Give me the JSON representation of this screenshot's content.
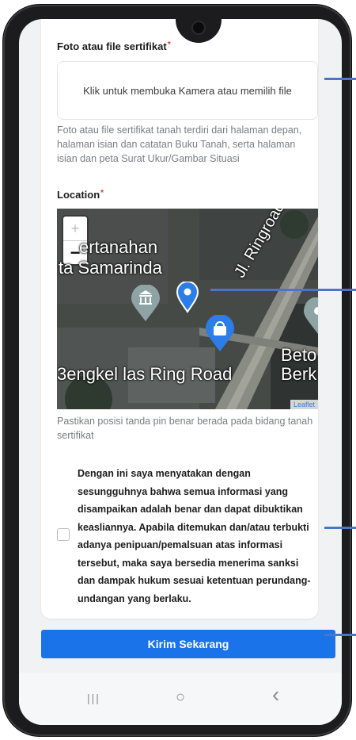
{
  "form": {
    "photo_label": "Foto atau file sertifikat",
    "required_mark": "*",
    "upload_text": "Klik untuk membuka Kamera atau memilih file",
    "photo_helper": "Foto atau file sertifikat tanah terdiri dari halaman depan, halaman isian dan catatan Buku Tanah, serta halaman isian dan peta Surat Ukur/Gambar Situasi",
    "location_label": "Location",
    "location_helper": "Pastikan posisi tanda pin benar berada pada bidang tanah sertifikat",
    "consent_text": "Dengan ini saya menyatakan dengan sesungguhnya bahwa semua informasi yang disampaikan adalah benar dan dapat dibuktikan keasliannya. Apabila ditemukan dan/atau terbukti adanya penipuan/pemalsuan atas informasi tersebut, maka saya bersedia menerima sanksi dan dampak hukum sesuai ketentuan perundang-undangan yang berlaku.",
    "submit_label": "Kirim Sekarang"
  },
  "map": {
    "zoom_in": "+",
    "zoom_out": "−",
    "place1_line1": "ertanahan",
    "place1_line2": "ta Samarinda",
    "road": "Jl. Ringroad",
    "place2": "3engkel las Ring Road",
    "place3_line1": "Beto",
    "place3_line2": "Berk",
    "attribution": "Leaflet"
  },
  "nav": {
    "recent": "|||",
    "home": "○",
    "back": "‹"
  },
  "colors": {
    "accent": "#1a73e8",
    "required": "#e0352b",
    "annotation": "#4a76c4"
  }
}
